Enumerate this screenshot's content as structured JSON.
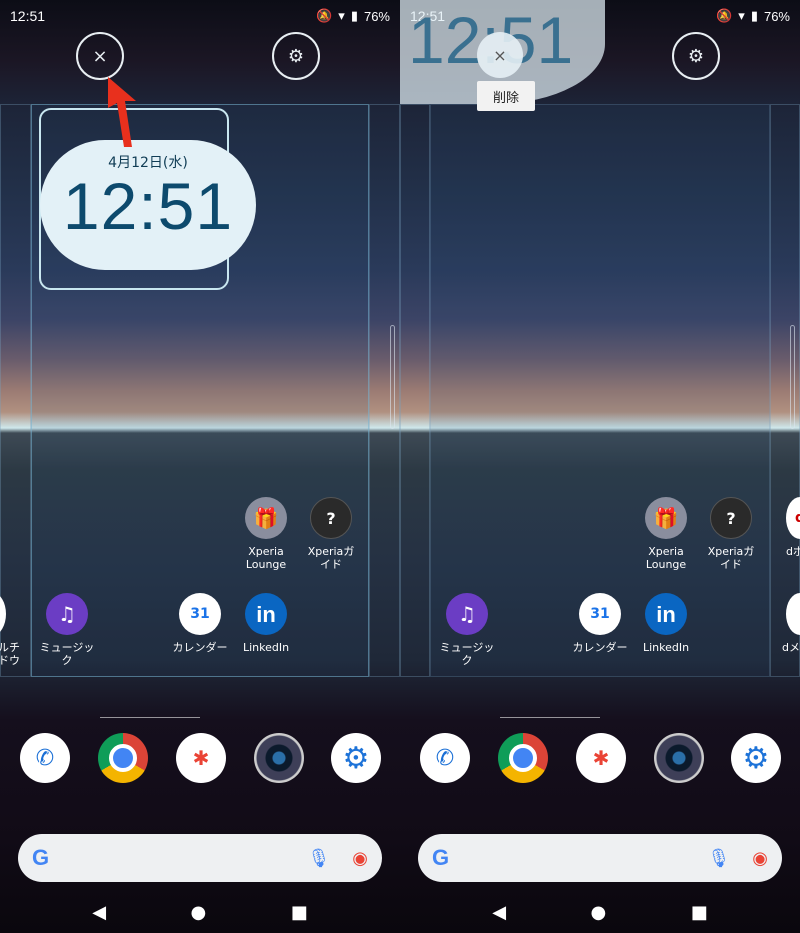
{
  "status": {
    "time": "12:51",
    "battery": "76%"
  },
  "left": {
    "clock_date": "4月12日(水)",
    "clock_time": "12:51",
    "close_icon": "×",
    "settings_icon": "⚙",
    "apps": {
      "xperia_lounge": "Xperia\nLounge",
      "xperia_guide": "Xperiaガイド",
      "music": "ミュージック",
      "calendar": "カレンダー",
      "linkedin": "LinkedIn",
      "dmail_partial": "メルチ\nドウ"
    }
  },
  "right": {
    "dragging_time": "12:51",
    "remove_label": "削除",
    "apps": {
      "xperia_lounge": "Xperia\nLounge",
      "xperia_guide": "Xperiaガイド",
      "music": "ミュージック",
      "calendar": "カレンダー",
      "linkedin": "LinkedIn",
      "dpoint_partial": "dポ",
      "dmail": "dメルチ\nドウ",
      "right_partial_dmail": "dメ",
      "right_partial_dpoint": "dポ"
    }
  },
  "icons": {
    "calendar_day": "31",
    "linkedin_glyph": "in",
    "music_glyph": "♫",
    "gift_glyph": "🎁",
    "guide_glyph": "?",
    "search_g": "G",
    "mic": "🎙",
    "lens": "◉",
    "phone": "✆",
    "settings": "⚙",
    "nav_back": "◀",
    "nav_home": "●",
    "nav_recent": "■"
  }
}
